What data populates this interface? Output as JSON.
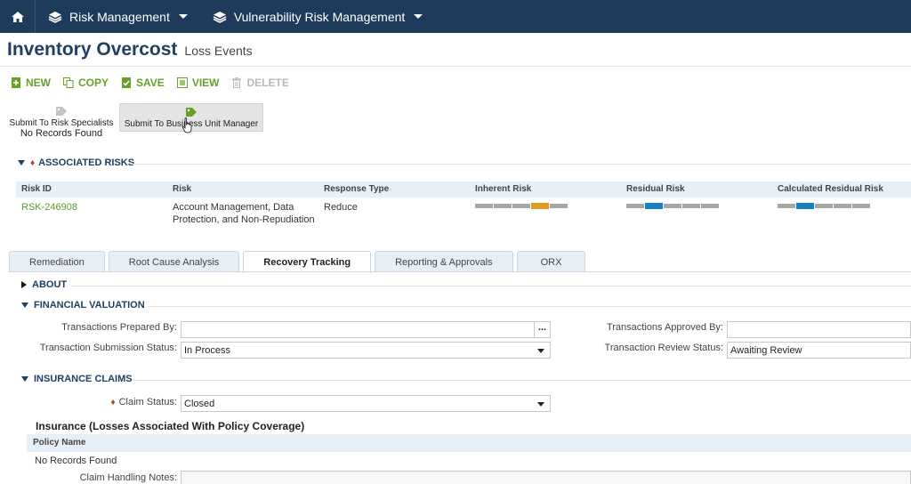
{
  "nav": {
    "items": [
      {
        "label": "Risk Management"
      },
      {
        "label": "Vulnerability Risk Management"
      }
    ]
  },
  "page": {
    "title": "Inventory Overcost",
    "subtitle": "Loss Events"
  },
  "toolbar": {
    "new_label": "NEW",
    "copy_label": "COPY",
    "save_label": "SAVE",
    "view_label": "VIEW",
    "delete_label": "DELETE"
  },
  "workflow": {
    "submit_specialists": "Submit To Risk Specialists",
    "no_records": "No Records Found",
    "submit_manager": "Submit To Business Unit Manager"
  },
  "associated_risks": {
    "header": "ASSOCIATED RISKS",
    "columns": [
      "Risk ID",
      "Risk",
      "Response Type",
      "Inherent Risk",
      "Residual Risk",
      "Calculated Residual Risk"
    ],
    "rows": [
      {
        "risk_id": "RSK-246908",
        "risk_line1": "Account Management, Data",
        "risk_line2": "Protection, and Non-Repudiation",
        "response_type": "Reduce",
        "inherent_level": 4,
        "residual_level": 2,
        "calculated_residual_level": 2
      }
    ],
    "colors": {
      "inherent": "#e09a1f",
      "residual": "#1a7fc1",
      "meter_bg": "#a6a6a6"
    }
  },
  "tabs": [
    {
      "label": "Remediation"
    },
    {
      "label": "Root Cause Analysis"
    },
    {
      "label": "Recovery Tracking",
      "active": true
    },
    {
      "label": "Reporting & Approvals"
    },
    {
      "label": "ORX"
    }
  ],
  "sections": {
    "about": "ABOUT",
    "financial": "FINANCIAL VALUATION",
    "insurance": "INSURANCE CLAIMS"
  },
  "financial": {
    "prepared_by_label": "Transactions Prepared By:",
    "prepared_by_value": "",
    "approved_by_label": "Transactions Approved By:",
    "approved_by_value": "",
    "submission_status_label": "Transaction Submission Status:",
    "submission_status_value": "In Process",
    "review_status_label": "Transaction Review Status:",
    "review_status_value": "Awaiting Review"
  },
  "insurance": {
    "claim_status_label": "Claim Status:",
    "claim_status_value": "Closed",
    "table_title": "Insurance (Losses Associated With Policy Coverage)",
    "policy_column": "Policy Name",
    "no_records": "No Records Found",
    "notes_label": "Claim Handling Notes:"
  },
  "ellipsis": "..."
}
